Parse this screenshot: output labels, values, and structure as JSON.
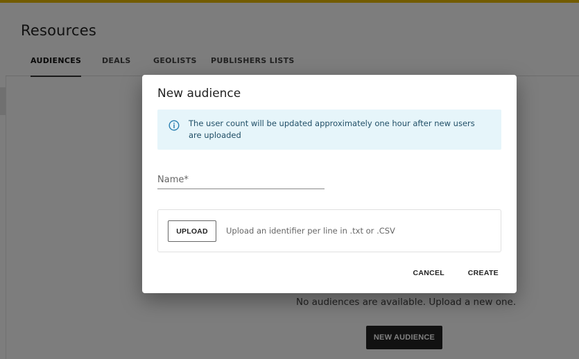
{
  "page": {
    "title": "Resources",
    "accent_color": "#e6b800"
  },
  "tabs": [
    {
      "label": "AUDIENCES",
      "active": true
    },
    {
      "label": "DEALS",
      "active": false
    },
    {
      "label": "GEOLISTS",
      "active": false
    },
    {
      "label": "PUBLISHERS LISTS",
      "active": false
    }
  ],
  "empty_state": {
    "message": "No audiences are available. Upload a new one.",
    "button_label": "NEW AUDIENCE"
  },
  "dialog": {
    "title": "New audience",
    "info": {
      "icon": "info-icon",
      "text": "The user count will be updated approximately one hour after new users are uploaded",
      "background": "#e6f5fa"
    },
    "name_field": {
      "placeholder": "Name*",
      "value": ""
    },
    "upload": {
      "button_label": "UPLOAD",
      "hint": "Upload an identifier per line in .txt or .CSV"
    },
    "cancel_label": "CANCEL",
    "create_label": "CREATE"
  }
}
